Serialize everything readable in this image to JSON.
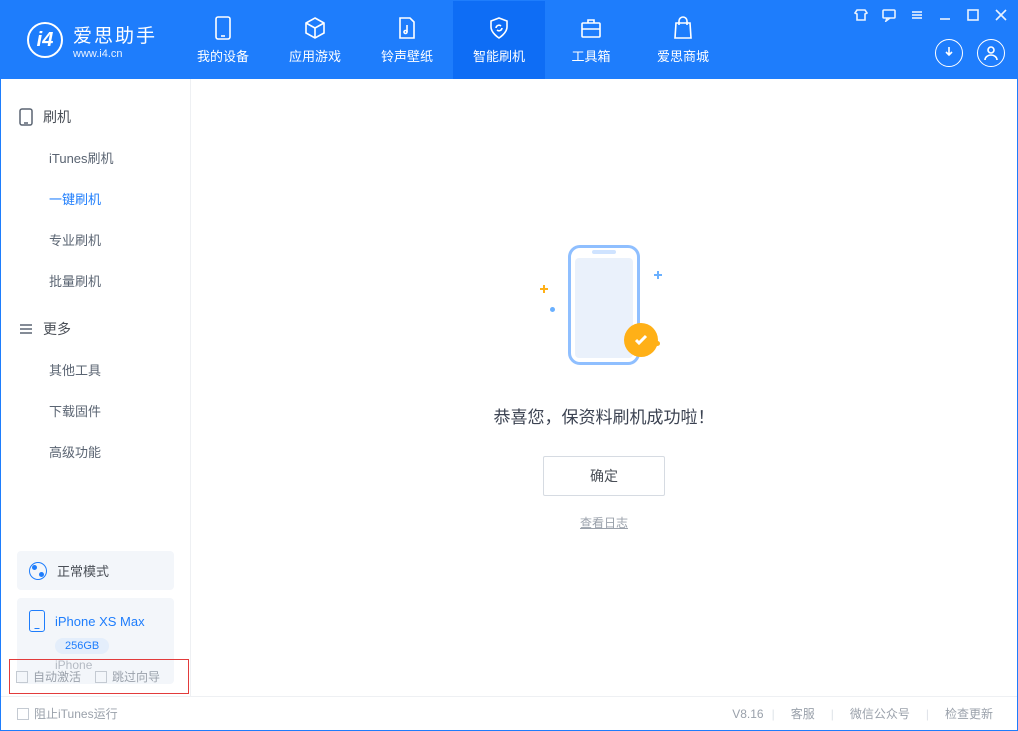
{
  "app": {
    "title": "爱思助手",
    "url": "www.i4.cn"
  },
  "nav": {
    "items": [
      {
        "label": "我的设备"
      },
      {
        "label": "应用游戏"
      },
      {
        "label": "铃声壁纸"
      },
      {
        "label": "智能刷机"
      },
      {
        "label": "工具箱"
      },
      {
        "label": "爱思商城"
      }
    ]
  },
  "sidebar": {
    "section1": {
      "title": "刷机",
      "items": [
        "iTunes刷机",
        "一键刷机",
        "专业刷机",
        "批量刷机"
      ]
    },
    "section2": {
      "title": "更多",
      "items": [
        "其他工具",
        "下载固件",
        "高级功能"
      ]
    },
    "mode": {
      "label": "正常模式"
    },
    "device": {
      "name": "iPhone XS Max",
      "capacity": "256GB",
      "type": "iPhone"
    }
  },
  "main": {
    "message": "恭喜您，保资料刷机成功啦！",
    "ok": "确定",
    "log": "查看日志"
  },
  "options": {
    "opt1": "自动激活",
    "opt2": "跳过向导"
  },
  "footer": {
    "block_itunes": "阻止iTunes运行",
    "version": "V8.16",
    "links": [
      "客服",
      "微信公众号",
      "检查更新"
    ]
  }
}
